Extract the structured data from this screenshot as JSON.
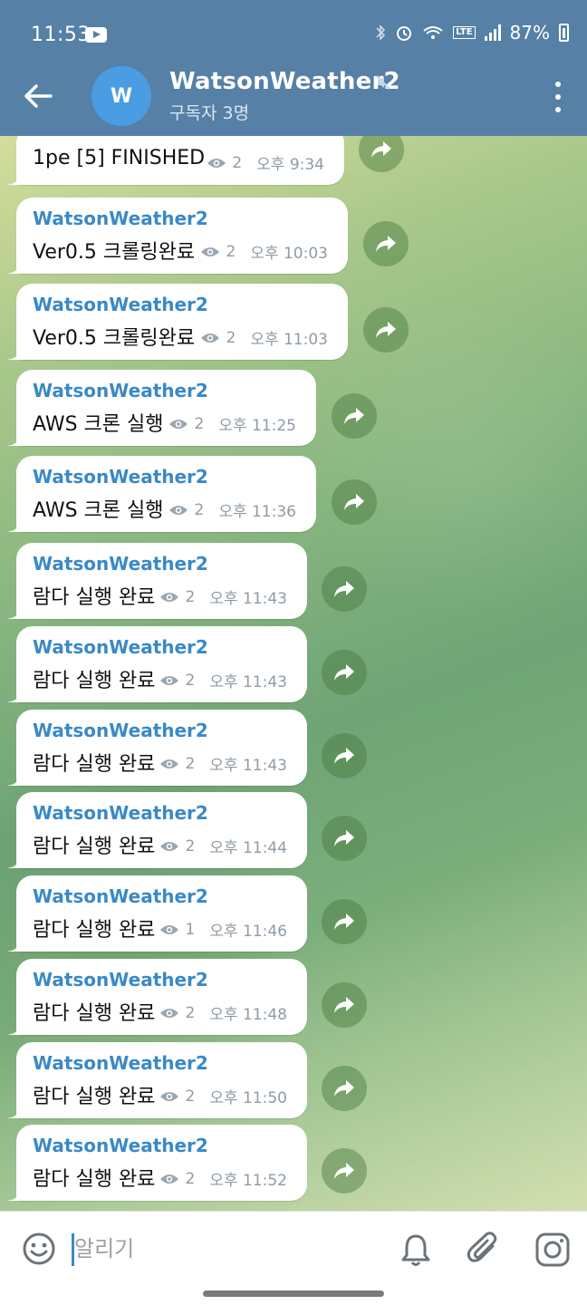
{
  "status_bar": {
    "time": "11:53",
    "battery": "87%",
    "network": "LTE"
  },
  "header": {
    "avatar_letter": "W",
    "title": "WatsonWeather2",
    "subtitle": "구독자 3명",
    "muted": true
  },
  "messages": [
    {
      "sender": "WatsonWeather2",
      "text": "1pe [5] FINISHED",
      "views": "2",
      "time": "오후 9:34"
    },
    {
      "sender": "WatsonWeather2",
      "text": "Ver0.5 크롤링완료",
      "views": "2",
      "time": "오후 10:03"
    },
    {
      "sender": "WatsonWeather2",
      "text": "Ver0.5 크롤링완료",
      "views": "2",
      "time": "오후 11:03"
    },
    {
      "sender": "WatsonWeather2",
      "text": "AWS 크론 실행",
      "views": "2",
      "time": "오후 11:25"
    },
    {
      "sender": "WatsonWeather2",
      "text": "AWS 크론 실행",
      "views": "2",
      "time": "오후 11:36"
    },
    {
      "sender": "WatsonWeather2",
      "text": "람다 실행 완료",
      "views": "2",
      "time": "오후 11:43"
    },
    {
      "sender": "WatsonWeather2",
      "text": "람다 실행 완료",
      "views": "2",
      "time": "오후 11:43"
    },
    {
      "sender": "WatsonWeather2",
      "text": "람다 실행 완료",
      "views": "2",
      "time": "오후 11:43"
    },
    {
      "sender": "WatsonWeather2",
      "text": "람다 실행 완료",
      "views": "2",
      "time": "오후 11:44"
    },
    {
      "sender": "WatsonWeather2",
      "text": "람다 실행 완료",
      "views": "1",
      "time": "오후 11:46"
    },
    {
      "sender": "WatsonWeather2",
      "text": "람다 실행 완료",
      "views": "2",
      "time": "오후 11:48"
    },
    {
      "sender": "WatsonWeather2",
      "text": "람다 실행 완료",
      "views": "2",
      "time": "오후 11:50"
    },
    {
      "sender": "WatsonWeather2",
      "text": "람다 실행 완료",
      "views": "2",
      "time": "오후 11:52"
    }
  ],
  "input": {
    "placeholder": "알리기"
  },
  "colors": {
    "header": "#5680a6",
    "sender_name": "#3a89c6",
    "avatar": "#4a9de3"
  },
  "icons": [
    "back-arrow-icon",
    "mute-icon",
    "more-vert-icon",
    "eye-icon",
    "forward-icon",
    "emoji-icon",
    "bell-icon",
    "paperclip-icon",
    "camera-icon"
  ]
}
